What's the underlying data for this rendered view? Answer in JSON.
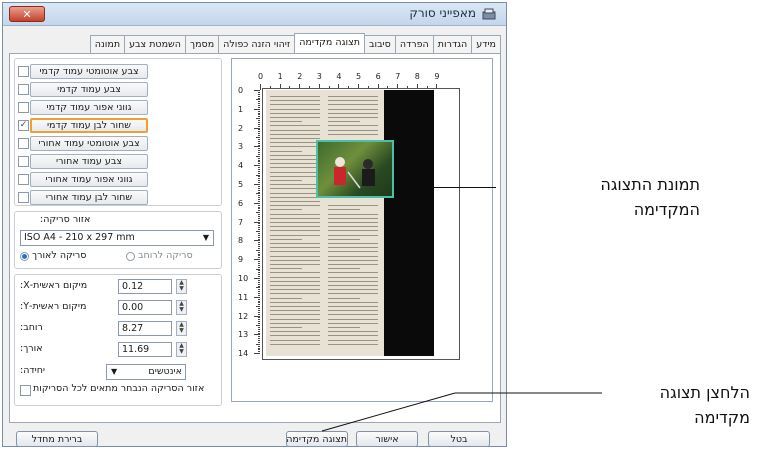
{
  "window": {
    "title": "מאפייני סורק",
    "close_glyph": "✕"
  },
  "tabs": [
    {
      "label": "מידע",
      "active": false
    },
    {
      "label": "הגדרות",
      "active": false
    },
    {
      "label": "הפרדה",
      "active": false
    },
    {
      "label": "סיבוב",
      "active": false
    },
    {
      "label": "תצוגה מקדימה",
      "active": true
    },
    {
      "label": "זיהוי הזנה כפולה",
      "active": false
    },
    {
      "label": "מסמך",
      "active": false
    },
    {
      "label": "השמטת צבע",
      "active": false
    },
    {
      "label": "תמונה",
      "active": false
    }
  ],
  "image_modes": [
    {
      "label": "צבע אוטומטי עמוד קדמי",
      "checked": false,
      "selected": false
    },
    {
      "label": "צבע עמוד קדמי",
      "checked": false,
      "selected": false
    },
    {
      "label": "גווני אפור עמוד קדמי",
      "checked": false,
      "selected": false
    },
    {
      "label": "שחור לבן עמוד קדמי",
      "checked": true,
      "selected": true
    },
    {
      "label": "צבע אוטומטי עמוד אחורי",
      "checked": false,
      "selected": false
    },
    {
      "label": "צבע עמוד אחורי",
      "checked": false,
      "selected": false
    },
    {
      "label": "גווני אפור עמוד אחורי",
      "checked": false,
      "selected": false
    },
    {
      "label": "שחור לבן עמוד אחורי",
      "checked": false,
      "selected": false
    }
  ],
  "scan_area": {
    "label": "אזור סריקה:",
    "value": "ISO A4 - 210 x 297 mm",
    "orientation_portrait": "סריקה לאורך",
    "orientation_landscape": "סריקה לרוחב",
    "portrait_selected": true
  },
  "coords": {
    "x_label": "מיקום ראשית-X:",
    "x_value": "0.12",
    "y_label": "מיקום ראשית-Y:",
    "y_value": "0.00",
    "width_label": "רוחב:",
    "width_value": "8.27",
    "length_label": "אורך:",
    "length_value": "11.69",
    "unit_label": "יחידה:",
    "unit_value": "אינטשים",
    "apply_all_label": "אזור הסריקה הנבחר מתאים לכל הסריקות"
  },
  "ruler": {
    "top": [
      "0",
      "1",
      "2",
      "3",
      "4",
      "5",
      "6",
      "7",
      "8",
      "9"
    ],
    "left": [
      "0",
      "1",
      "2",
      "3",
      "4",
      "5",
      "6",
      "7",
      "8",
      "9",
      "10",
      "11",
      "12",
      "13",
      "14"
    ]
  },
  "buttons": {
    "defaults": "ברירת מחדל",
    "preview": "תצוגה מקדימה",
    "ok": "אישור",
    "cancel": "בטל"
  },
  "callouts": {
    "preview_image_line1": "תמונת התצוגה",
    "preview_image_line2": "המקדימה",
    "preview_button_line1": "הלחצן תצוגה",
    "preview_button_line2": "מקדימה"
  },
  "colors": {
    "selected_outline": "#f0a030",
    "photo_border": "#4dbfa8"
  }
}
